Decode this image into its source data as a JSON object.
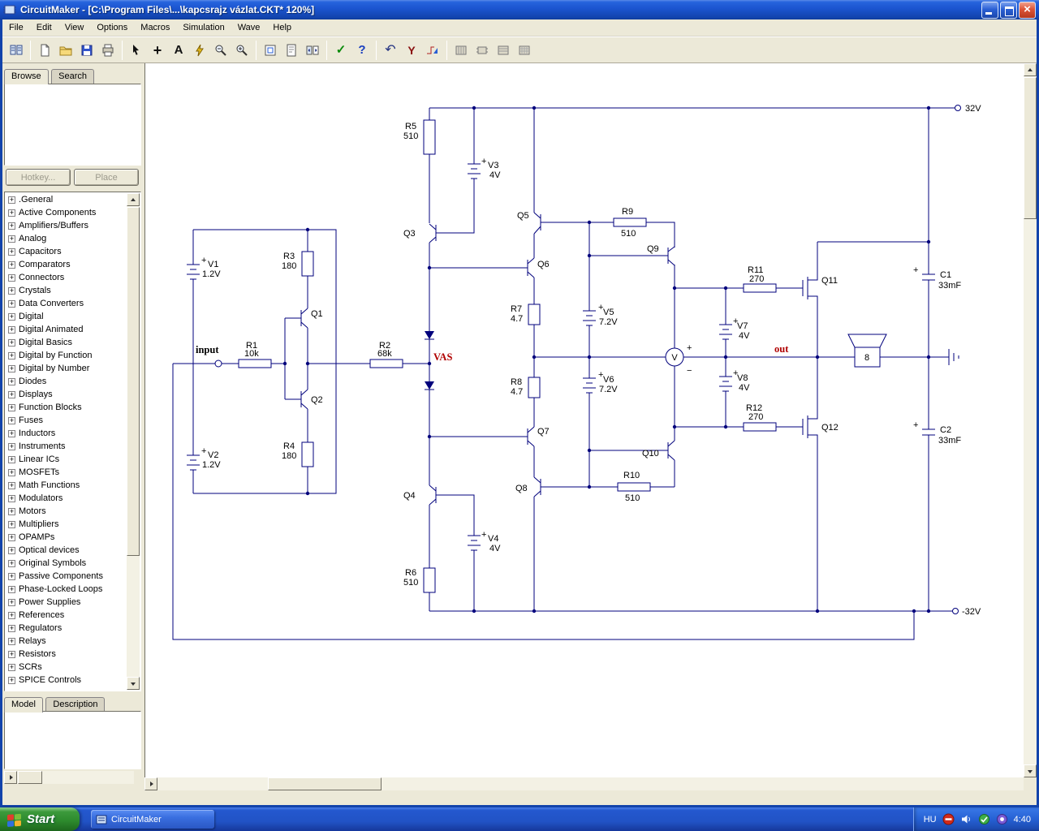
{
  "window": {
    "title": "CircuitMaker - [C:\\Program Files\\...\\kapcsrajz vázlat.CKT* 120%]"
  },
  "menu": {
    "items": [
      "File",
      "Edit",
      "View",
      "Options",
      "Macros",
      "Simulation",
      "Wave",
      "Help"
    ]
  },
  "toolbar": {
    "glyphs": {
      "wire": "+",
      "text": "A",
      "help": "?",
      "undo": "↶",
      "probe": "Y",
      "check": "✓"
    }
  },
  "sidebar": {
    "tabs": [
      "Browse",
      "Search"
    ],
    "hotkey_button": "Hotkey...",
    "place_button": "Place",
    "bottom_tabs": [
      "Model",
      "Description"
    ],
    "categories": [
      ".General",
      "Active Components",
      "Amplifiers/Buffers",
      "Analog",
      "Capacitors",
      "Comparators",
      "Connectors",
      "Crystals",
      "Data Converters",
      "Digital",
      "Digital Animated",
      "Digital Basics",
      "Digital by Function",
      "Digital by Number",
      "Diodes",
      "Displays",
      "Function Blocks",
      "Fuses",
      "Inductors",
      "Instruments",
      "Linear ICs",
      "MOSFETs",
      "Math Functions",
      "Modulators",
      "Motors",
      "Multipliers",
      "OPAMPs",
      "Optical devices",
      "Original Symbols",
      "Passive Components",
      "Phase-Locked Loops",
      "Power Supplies",
      "References",
      "Regulators",
      "Relays",
      "Resistors",
      "SCRs",
      "SPICE Controls"
    ]
  },
  "schematic": {
    "power_pos": "32V",
    "power_neg": "-32V",
    "input_label": "input",
    "out_label": "out",
    "vas_label": "VAS",
    "speaker_impedance": "8",
    "meter_letter": "V",
    "plus": "+",
    "minus": "−",
    "parts": {
      "r1": {
        "name": "R1",
        "value": "10k"
      },
      "r2": {
        "name": "R2",
        "value": "68k"
      },
      "r3": {
        "name": "R3",
        "value": "180"
      },
      "r4": {
        "name": "R4",
        "value": "180"
      },
      "r5": {
        "name": "R5",
        "value": "510"
      },
      "r6": {
        "name": "R6",
        "value": "510"
      },
      "r7": {
        "name": "R7",
        "value": "4.7"
      },
      "r8": {
        "name": "R8",
        "value": "4.7"
      },
      "r9": {
        "name": "R9",
        "value": "510"
      },
      "r10": {
        "name": "R10",
        "value": "510"
      },
      "r11": {
        "name": "R11",
        "value": "270"
      },
      "r12": {
        "name": "R12",
        "value": "270"
      },
      "v1": {
        "name": "V1",
        "value": "1.2V"
      },
      "v2": {
        "name": "V2",
        "value": "1.2V"
      },
      "v3": {
        "name": "V3",
        "value": "4V"
      },
      "v4": {
        "name": "V4",
        "value": "4V"
      },
      "v5": {
        "name": "V5",
        "value": "7.2V"
      },
      "v6": {
        "name": "V6",
        "value": "7.2V"
      },
      "v7": {
        "name": "V7",
        "value": "4V"
      },
      "v8": {
        "name": "V8",
        "value": "4V"
      },
      "c1": {
        "name": "C1",
        "value": "33mF"
      },
      "c2": {
        "name": "C2",
        "value": "33mF"
      },
      "q1": {
        "name": "Q1"
      },
      "q2": {
        "name": "Q2"
      },
      "q3": {
        "name": "Q3"
      },
      "q4": {
        "name": "Q4"
      },
      "q5": {
        "name": "Q5"
      },
      "q6": {
        "name": "Q6"
      },
      "q7": {
        "name": "Q7"
      },
      "q8": {
        "name": "Q8"
      },
      "q9": {
        "name": "Q9"
      },
      "q10": {
        "name": "Q10"
      },
      "q11": {
        "name": "Q11"
      },
      "q12": {
        "name": "Q12"
      }
    }
  },
  "taskbar": {
    "start": "Start",
    "task": "CircuitMaker",
    "lang": "HU",
    "time": "4:40"
  },
  "colors": {
    "wire": "#00007c",
    "highlight_red": "#b00000",
    "titlebar_blue": "#1b54cf",
    "start_green": "#2e8b2e"
  }
}
